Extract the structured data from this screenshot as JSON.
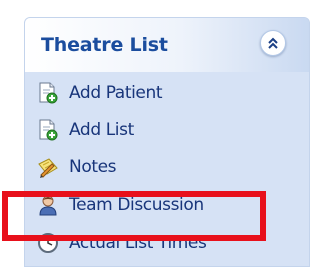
{
  "panel": {
    "title": "Theatre List",
    "collapse_icon": "double-chevron-up-icon",
    "items": [
      {
        "label": "Add Patient",
        "icon": "document-add-icon"
      },
      {
        "label": "Add List",
        "icon": "document-add-icon"
      },
      {
        "label": "Notes",
        "icon": "notes-pencil-icon"
      },
      {
        "label": "Team Discussion",
        "icon": "person-icon"
      },
      {
        "label": "Actual List Times",
        "icon": "clock-icon"
      }
    ]
  },
  "colors": {
    "title_text": "#1b4d9e",
    "item_text": "#18357a",
    "panel_body": "#d6e2f5",
    "highlight": "#e8101b"
  }
}
